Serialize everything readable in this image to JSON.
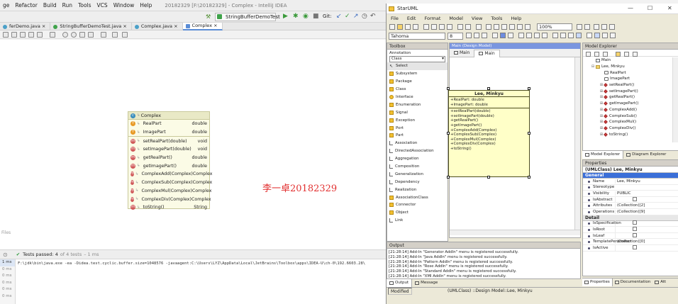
{
  "intellij": {
    "menu": [
      "ge",
      "Refactor",
      "Build",
      "Run",
      "Tools",
      "VCS",
      "Window",
      "Help"
    ],
    "title": "20182329 [F:\\20182329] - Complex - IntelliJ IDEA",
    "run_config": "StringBufferDemoTest",
    "git_label": "Git:",
    "tabs": [
      "ferDemo.java",
      "StringBufferDemoTest.java",
      "Complex.java",
      "Complex"
    ],
    "uml": {
      "class_name": "Complex",
      "fields": [
        {
          "name": "RealPart",
          "type": "double"
        },
        {
          "name": "ImagePart",
          "type": "double"
        }
      ],
      "methods": [
        {
          "name": "setRealPart(double)",
          "type": "void"
        },
        {
          "name": "setImagePart(double)",
          "type": "void"
        },
        {
          "name": "getRealPart()",
          "type": "double"
        },
        {
          "name": "getImagePart()",
          "type": "double"
        },
        {
          "name": "ComplexAdd(Complex)",
          "type": "Complex"
        },
        {
          "name": "ComplexSub(Complex)",
          "type": "Complex"
        },
        {
          "name": "ComplexMul(Complex)",
          "type": "Complex"
        },
        {
          "name": "ComplexDiv(Complex)",
          "type": "Complex"
        },
        {
          "name": "toString()",
          "type": "String"
        }
      ]
    },
    "watermark": "李一卓20182329",
    "files_label": "Files",
    "run": {
      "status": "Tests passed:",
      "count": "4",
      "of": "of 4 tests",
      "time": "– 1 ms"
    },
    "side_times": [
      "1 ms",
      "0 ms",
      "0 ms",
      "0 ms",
      "0 ms",
      "0 ms"
    ],
    "console": "F:\\jdk\\bin\\java.exe -ea -Didea.test.cyclic.buffer.size=1048576 -javaagent:C:\\Users\\LYZ\\AppData\\Local\\JetBrains\\Toolbox\\apps\\IDEA-U\\ch-0\\192.6603.28\\"
  },
  "staruml": {
    "title": "StarUML",
    "menu": [
      "File",
      "Edit",
      "Format",
      "Model",
      "View",
      "Tools",
      "Help"
    ],
    "zoom": "100%",
    "font_name": "Tahoma",
    "font_size": "8",
    "toolbox": {
      "header": "Toolbox",
      "annotation": "Annotation",
      "category": "Class",
      "items": [
        "Select",
        "Subsystem",
        "Package",
        "Class",
        "Interface",
        "Enumeration",
        "Signal",
        "Exception",
        "Port",
        "Part",
        "Association",
        "DirectedAssociation",
        "Aggregation",
        "Composition",
        "Generalization",
        "Dependency",
        "Realization",
        "AssociationClass",
        "Connector",
        "Object",
        "Link"
      ]
    },
    "diagram": {
      "header": "Main (Design Model)",
      "tabs": [
        "Main",
        "Main"
      ],
      "class_name": "Lee, Minkyu",
      "attributes": [
        "+RealPart: double",
        "+ImagePart: double"
      ],
      "operations": [
        "+setRealPart(double)",
        "+setImagePart(double)",
        "+getRealPart()",
        "+getImagePart()",
        "+ComplexAdd(Complex)",
        "+ComplexSub(Complex)",
        "+ComplexMul(Complex)",
        "+ComplexDiv(Complex)",
        "+toString()"
      ]
    },
    "explorer": {
      "header": "Model Explorer",
      "items": [
        {
          "label": "Main",
          "kind": "diagram",
          "indent": 0
        },
        {
          "label": "Lee, Minkyu",
          "kind": "class",
          "indent": 0
        },
        {
          "label": "RealPart",
          "kind": "att",
          "indent": 1
        },
        {
          "label": "ImagePart",
          "kind": "att",
          "indent": 1
        },
        {
          "label": "setRealPart()",
          "kind": "op",
          "indent": 1
        },
        {
          "label": "setImagePart()",
          "kind": "op",
          "indent": 1
        },
        {
          "label": "getRealPart()",
          "kind": "op",
          "indent": 1
        },
        {
          "label": "getImagePart()",
          "kind": "op",
          "indent": 1
        },
        {
          "label": "ComplexAdd()",
          "kind": "op",
          "indent": 1
        },
        {
          "label": "ComplexSub()",
          "kind": "op",
          "indent": 1
        },
        {
          "label": "ComplexMul()",
          "kind": "op",
          "indent": 1
        },
        {
          "label": "ComplexDiv()",
          "kind": "op",
          "indent": 1
        },
        {
          "label": "toString()",
          "kind": "op",
          "indent": 1
        }
      ],
      "tabs": [
        "Model Explorer",
        "Diagram Explorer"
      ]
    },
    "properties": {
      "header": "Properties",
      "title": "(UMLClass) Lee, Minkyu",
      "general_label": "General",
      "detail_label": "Detail",
      "general": [
        {
          "k": "Name",
          "v": "Lee, Minkyu"
        },
        {
          "k": "Stereotype",
          "v": ""
        },
        {
          "k": "Visibility",
          "v": "PUBLIC"
        },
        {
          "k": "IsAbstract",
          "v": "chk"
        },
        {
          "k": "Attributes",
          "v": "(Collection)[2]"
        },
        {
          "k": "Operations",
          "v": "(Collection)[9]"
        }
      ],
      "detail": [
        {
          "k": "IsSpecification",
          "v": "chk"
        },
        {
          "k": "IsRoot",
          "v": "chk"
        },
        {
          "k": "IsLeaf",
          "v": "chk"
        },
        {
          "k": "TemplatePerameter",
          "v": "(Collection)[0]"
        },
        {
          "k": "IsActive",
          "v": "chk"
        }
      ],
      "tabs": [
        "Properties",
        "Documentation",
        "Att"
      ]
    },
    "output": {
      "header": "Output",
      "lines": [
        "[21:28:14]  Add-In \"Generator AddIn\" menu is registered successfully.",
        "[21:28:14]  Add-In \"Java AddIn\" menu is registered successfully.",
        "[21:28:14]  Add-In \"Pattern AddIn\" menu is registered successfully.",
        "[21:28:14]  Add-In \"Rose AddIn\" menu is registered successfully.",
        "[21:28:14]  Add-In \"Standard AddIn\" menu is registered successfully.",
        "[21:28:14]  Add-In \"XMI AddIn\" menu is registered successfully."
      ],
      "tabs": [
        "Output",
        "Message"
      ]
    },
    "status": {
      "state": "Modified",
      "info": "(UMLClass) ::Design Model::Lee, Minkyu"
    }
  }
}
